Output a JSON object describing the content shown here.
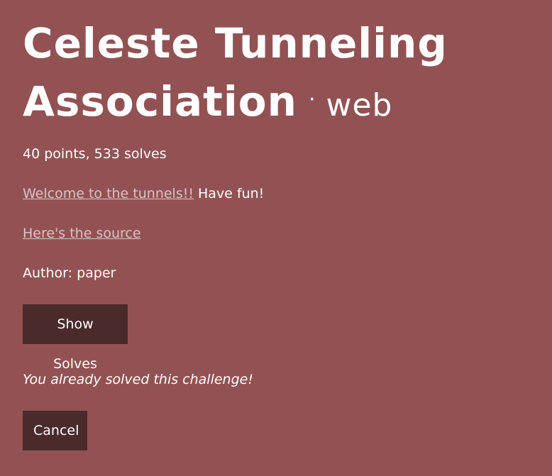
{
  "challenge": {
    "name": "Celeste Tunneling Association",
    "separator": "·",
    "category": "web",
    "points_solves": "40 points, 533 solves",
    "description_link": "Welcome to the tunnels!!",
    "description_rest": " Have fun!",
    "source_link": "Here's the source",
    "author": "Author: paper",
    "solved_message": "You already solved this challenge!"
  },
  "buttons": {
    "show_solves": "Show Solves",
    "cancel": "Cancel"
  },
  "colors": {
    "background": "#925253",
    "button": "#4a2a2b",
    "link": "#d7c4c4",
    "text": "#ffffff"
  }
}
